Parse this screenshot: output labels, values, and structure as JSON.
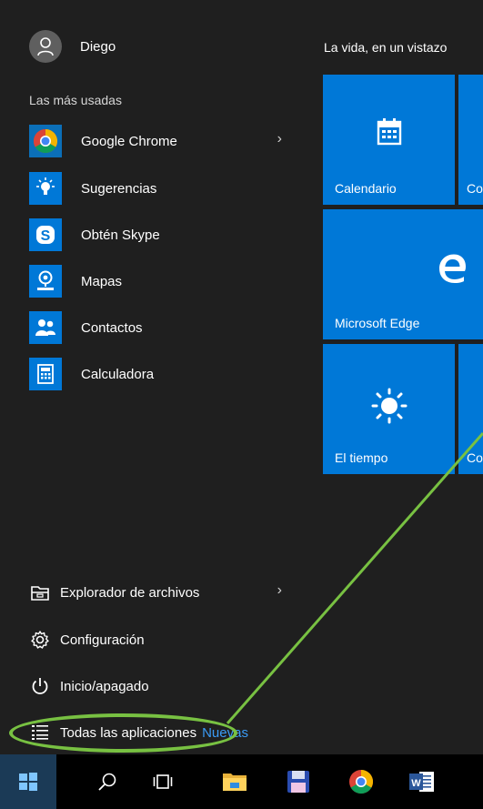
{
  "user": {
    "name": "Diego"
  },
  "most_used": {
    "title": "Las más usadas",
    "apps": [
      {
        "label": "Google Chrome",
        "icon": "chrome-icon",
        "has_submenu": true
      },
      {
        "label": "Sugerencias",
        "icon": "lightbulb-icon"
      },
      {
        "label": "Obtén Skype",
        "icon": "skype-icon"
      },
      {
        "label": "Mapas",
        "icon": "map-pin-icon"
      },
      {
        "label": "Contactos",
        "icon": "people-icon"
      },
      {
        "label": "Calculadora",
        "icon": "calculator-icon"
      }
    ]
  },
  "system": {
    "file_explorer": "Explorador de archivos",
    "settings": "Configuración",
    "power": "Inicio/apagado",
    "all_apps": "Todas las aplicaciones",
    "new_badge": "Nuevas"
  },
  "tiles": {
    "group_title": "La vida, en un vistazo",
    "items": [
      {
        "label": "Calendario",
        "icon": "calendar-icon"
      },
      {
        "label": "Co",
        "icon": "mail-icon"
      },
      {
        "label": "Microsoft Edge",
        "icon": "edge-icon"
      },
      {
        "label": "El tiempo",
        "icon": "sun-icon"
      },
      {
        "label": "Co",
        "icon": "unknown-icon"
      }
    ]
  },
  "taskbar": {
    "items": [
      "windows-start-icon",
      "search-icon",
      "task-view-icon",
      "file-explorer-icon",
      "save-disk-icon",
      "chrome-icon",
      "word-icon"
    ]
  },
  "colors": {
    "accent": "#0078d7",
    "menu_bg": "#1f1f1f",
    "highlight": "#78c142",
    "new_badge": "#3a9bf5"
  }
}
